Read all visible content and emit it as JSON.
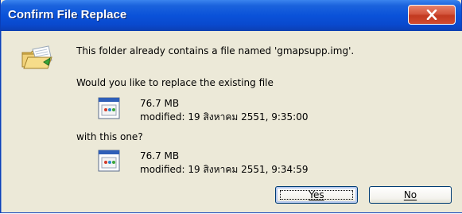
{
  "window": {
    "title": "Confirm File Replace",
    "close_icon": "close-icon"
  },
  "message": {
    "intro": "This folder already contains a file named 'gmapsupp.img'.",
    "question": "Would you like to replace the existing file",
    "with_text": "with this one?"
  },
  "existing_file": {
    "size": "76.7 MB",
    "modified": "modified: 19 สิงหาคม 2551, 9:35:00",
    "icon": "file-icon"
  },
  "new_file": {
    "size": "76.7 MB",
    "modified": "modified: 19 สิงหาคม 2551, 9:34:59",
    "icon": "file-icon"
  },
  "buttons": {
    "yes_label": "Yes",
    "no_label": "No"
  },
  "colors": {
    "titlebar": "#0a52d9",
    "dialog_bg": "#ece9d8",
    "close_button": "#c23a20"
  }
}
